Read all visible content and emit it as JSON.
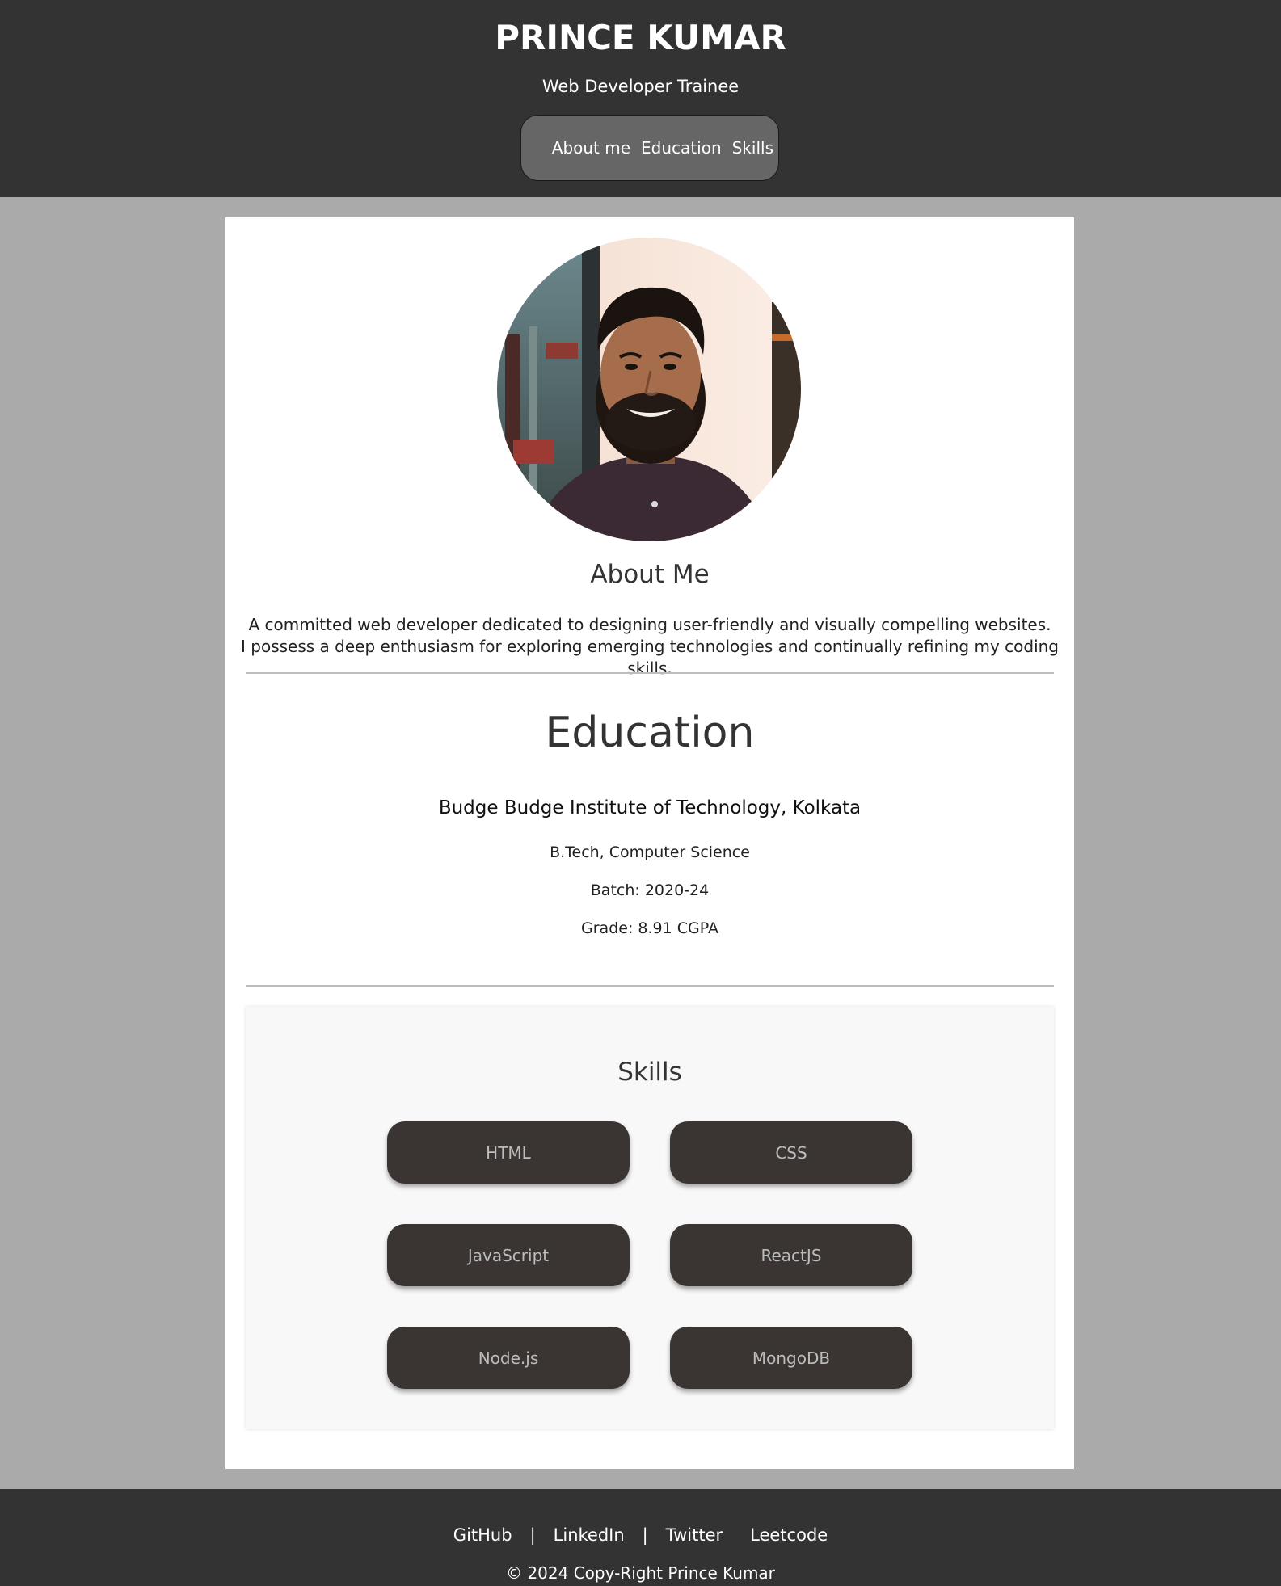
{
  "header": {
    "name": "PRINCE KUMAR",
    "subtitle": "Web Developer Trainee",
    "nav": [
      "About me",
      "Education",
      "Skills"
    ]
  },
  "about": {
    "title": "About Me",
    "line1": "A committed web developer dedicated to designing user-friendly and visually compelling websites.",
    "line2": "I possess a deep enthusiasm for exploring emerging technologies and continually refining my coding skills."
  },
  "education": {
    "title": "Education",
    "institution": "Budge Budge Institute of Technology, Kolkata",
    "degree": "B.Tech, Computer Science",
    "batch": "Batch: 2020-24",
    "grade": "Grade: 8.91 CGPA"
  },
  "skills": {
    "title": "Skills",
    "items": [
      "HTML",
      "CSS",
      "JavaScript",
      "ReactJS",
      "Node.js",
      "MongoDB"
    ]
  },
  "footer": {
    "links": [
      "GitHub",
      "LinkedIn",
      "Twitter",
      "Leetcode"
    ],
    "separator": "|",
    "copyright": "© 2024 Copy-Right Prince Kumar"
  },
  "colors": {
    "header_bg": "#333333",
    "page_bg": "#aaaaaa",
    "skill_bg": "#3a3533",
    "nav_bg": "#666666"
  }
}
